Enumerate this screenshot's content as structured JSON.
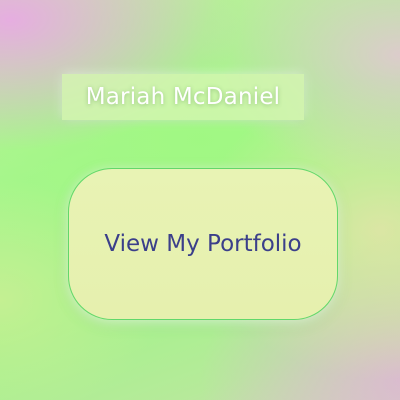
{
  "profile": {
    "name": "Mariah McDaniel"
  },
  "cta": {
    "label": "View My Portfolio"
  },
  "colors": {
    "name_text": "#ffffff",
    "button_text": "#3b3f8a",
    "button_border": "#62d86a",
    "button_fill": "#e8f3b4",
    "background_primary": "#a8f58c",
    "background_accent": "#e8aae4"
  }
}
